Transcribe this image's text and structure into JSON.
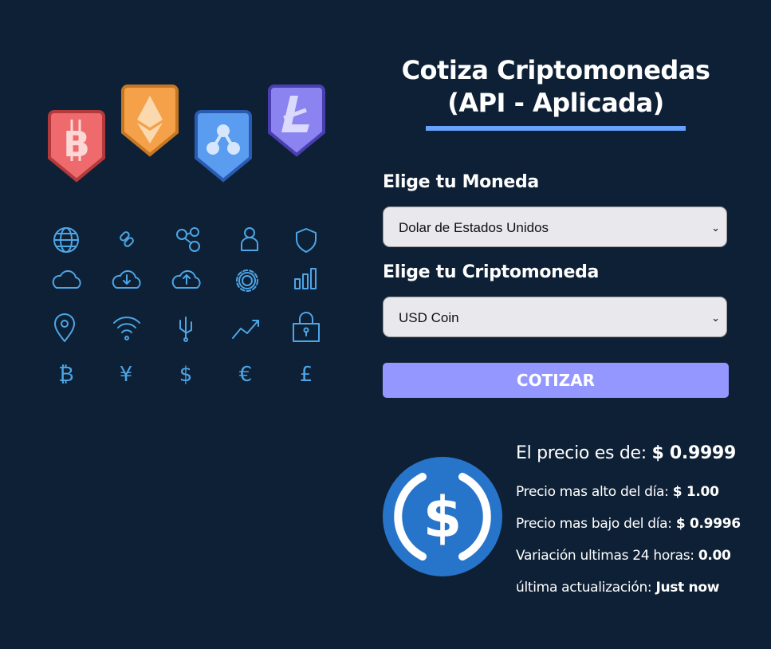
{
  "header": {
    "title": "Cotiza Criptomonedas (API - Aplicada)"
  },
  "form": {
    "currency_label": "Elige tu Moneda",
    "currency_value": "Dolar de Estados Unidos",
    "crypto_label": "Elige tu Criptomoneda",
    "crypto_value": "USD Coin",
    "submit_label": "COTIZAR"
  },
  "result": {
    "price_label": "El precio es de:",
    "price_value": "$ 0.9999",
    "high_label": "Precio mas alto del día:",
    "high_value": "$ 1.00",
    "low_label": "Precio mas bajo del día:",
    "low_value": "$ 0.9996",
    "change_label": "Variación ultimas 24 horas:",
    "change_value": "0.00",
    "updated_label": "última actualización:",
    "updated_value": "Just now"
  },
  "hero": {
    "badges": [
      {
        "icon": "bitcoin-icon",
        "color": "#ef6a6c"
      },
      {
        "icon": "ethereum-icon",
        "color": "#f5a14a"
      },
      {
        "icon": "ripple-icon",
        "color": "#5a9cf0"
      },
      {
        "icon": "litecoin-icon",
        "color": "#8a83f0"
      }
    ],
    "icon_grid": [
      "globe-icon",
      "link-icon",
      "network-icon",
      "user-icon",
      "shield-icon",
      "cloud-icon",
      "cloud-download-icon",
      "cloud-upload-icon",
      "gear-icon",
      "bar-chart-icon",
      "location-pin-icon",
      "wifi-icon",
      "usb-icon",
      "trend-up-icon",
      "padlock-icon",
      "bitcoin-symbol-icon",
      "yen-icon",
      "dollar-icon",
      "euro-icon",
      "pound-icon"
    ],
    "accent": "#4da6e6"
  },
  "colors": {
    "background": "#0e2035",
    "title_bar": "#66a2fe",
    "button": "#9497ff",
    "coin": "#2775ca"
  }
}
